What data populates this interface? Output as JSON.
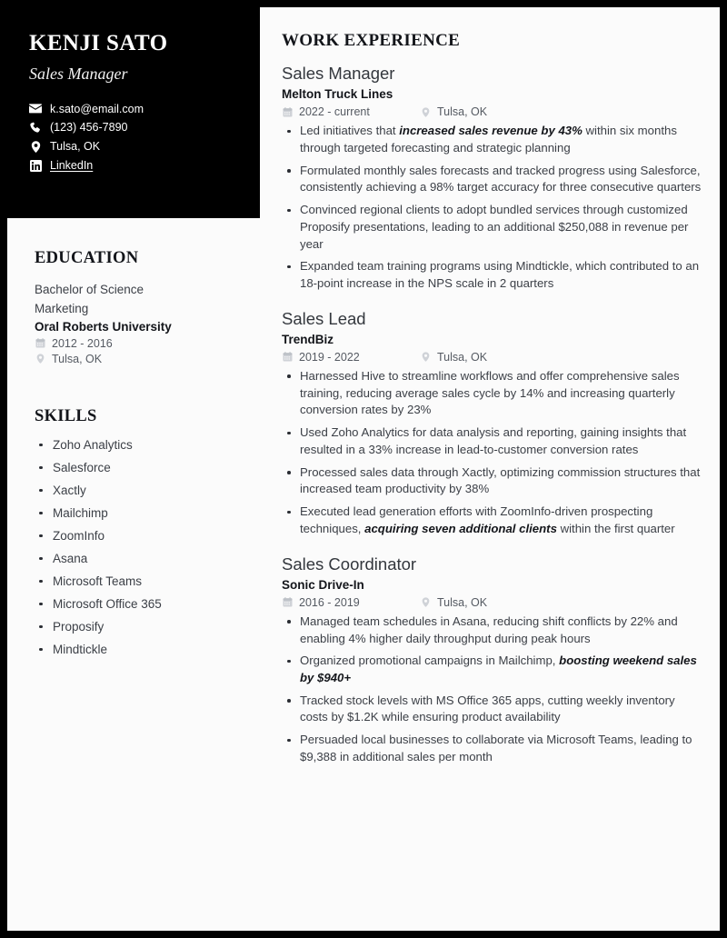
{
  "header": {
    "name": "KENJI SATO",
    "role": "Sales Manager",
    "contacts": [
      {
        "icon": "envelope-icon",
        "label": "k.sato@email.com",
        "link": false
      },
      {
        "icon": "phone-icon",
        "label": "(123) 456-7890",
        "link": false
      },
      {
        "icon": "location-pin-icon",
        "label": "Tulsa, OK",
        "link": false
      },
      {
        "icon": "linkedin-icon",
        "label": "LinkedIn",
        "link": true
      }
    ]
  },
  "education": {
    "heading": "EDUCATION",
    "degree": "Bachelor of Science",
    "field": "Marketing",
    "school": "Oral Roberts University",
    "dates": "2012 - 2016",
    "location": "Tulsa, OK"
  },
  "skills": {
    "heading": "SKILLS",
    "items": [
      "Zoho Analytics",
      "Salesforce",
      "Xactly",
      "Mailchimp",
      "ZoomInfo",
      "Asana",
      "Microsoft Teams",
      "Microsoft Office 365",
      "Proposify",
      "Mindtickle"
    ]
  },
  "experience": {
    "heading": "WORK EXPERIENCE",
    "jobs": [
      {
        "title": "Sales Manager",
        "company": "Melton Truck Lines",
        "dates": "2022 - current",
        "location": "Tulsa, OK",
        "bullets": [
          {
            "pre": "Led initiatives that ",
            "bold": "increased sales revenue by 43%",
            "post": " within six months through targeted forecasting and strategic planning"
          },
          {
            "pre": "Formulated monthly sales forecasts and tracked progress using Salesforce, consistently achieving a 98% target accuracy for three consecutive quarters",
            "bold": "",
            "post": ""
          },
          {
            "pre": "Convinced regional clients to adopt bundled services through customized Proposify presentations, leading to an additional $250,088 in revenue per year",
            "bold": "",
            "post": ""
          },
          {
            "pre": "Expanded team training programs using Mindtickle, which contributed to an 18-point increase in the NPS scale in 2 quarters",
            "bold": "",
            "post": ""
          }
        ]
      },
      {
        "title": "Sales Lead",
        "company": "TrendBiz",
        "dates": "2019 - 2022",
        "location": "Tulsa, OK",
        "bullets": [
          {
            "pre": "Harnessed Hive to streamline workflows and offer comprehensive sales training, reducing average sales cycle by 14% and increasing quarterly conversion rates by 23%",
            "bold": "",
            "post": ""
          },
          {
            "pre": "Used Zoho Analytics for data analysis and reporting, gaining insights that resulted in a 33% increase in lead-to-customer conversion rates",
            "bold": "",
            "post": ""
          },
          {
            "pre": "Processed sales data through Xactly, optimizing commission structures that increased team productivity by 38%",
            "bold": "",
            "post": ""
          },
          {
            "pre": "Executed lead generation efforts with ZoomInfo-driven prospecting techniques, ",
            "bold": "acquiring seven additional clients",
            "post": " within the first quarter"
          }
        ]
      },
      {
        "title": "Sales Coordinator",
        "company": "Sonic Drive-In",
        "dates": "2016 - 2019",
        "location": "Tulsa, OK",
        "bullets": [
          {
            "pre": "Managed team schedules in Asana, reducing shift conflicts by 22% and enabling 4% higher daily throughput during peak hours",
            "bold": "",
            "post": ""
          },
          {
            "pre": "Organized promotional campaigns in Mailchimp, ",
            "bold": "boosting weekend sales by $940+",
            "post": ""
          },
          {
            "pre": "Tracked stock levels with MS Office 365 apps, cutting weekly inventory costs by $1.2K while ensuring product availability",
            "bold": "",
            "post": ""
          },
          {
            "pre": "Persuaded local businesses to collaborate via Microsoft Teams, leading to $9,388 in additional sales per month",
            "bold": "",
            "post": ""
          }
        ]
      }
    ]
  },
  "colors": {
    "frame": "#000000",
    "page_bg": "#fbfbfb",
    "hero_bg": "#000000",
    "heading": "#13151a",
    "body_text": "#3b3f46",
    "muted_icon": "#c9ccd1"
  }
}
